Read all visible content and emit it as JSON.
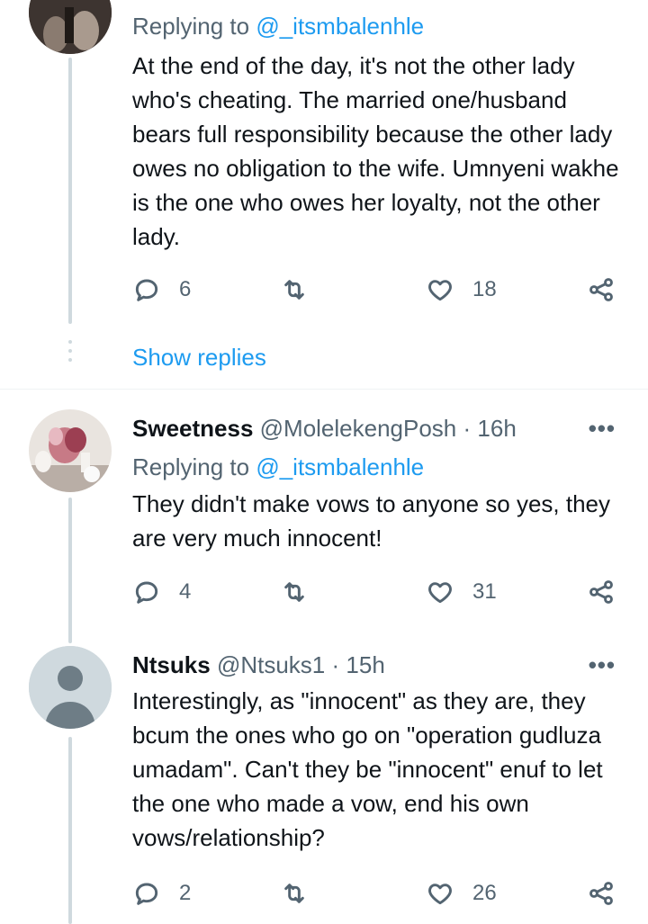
{
  "tweets": [
    {
      "replying_prefix": "Replying to",
      "replying_to": "@_itsmbalenhle",
      "text": "At the end of the day, it's not the other lady who's cheating. The married one/husband bears full responsibility because the other lady owes no obligation to the wife. Umnyeni wakhe is the one who owes her loyalty, not the other lady.",
      "replies": "6",
      "likes": "18",
      "show_replies": "Show replies"
    },
    {
      "name": "Sweetness",
      "handle": "@MolelekengPosh",
      "separator": "·",
      "time": "16h",
      "replying_prefix": "Replying to",
      "replying_to": "@_itsmbalenhle",
      "text": "They didn't make vows to anyone so yes, they are very much innocent!",
      "replies": "4",
      "likes": "31",
      "more": "•••"
    },
    {
      "name": "Ntsuks",
      "handle": "@Ntsuks1",
      "separator": "·",
      "time": "15h",
      "text": "Interestingly, as \"innocent\" as they are, they bcum the ones who go on \"operation gudluza umadam\". Can't they be \"innocent\" enuf to let the one who made a vow, end his own vows/relationship?",
      "replies": "2",
      "likes": "26",
      "more": "•••"
    }
  ],
  "icons": {
    "reply": "reply-icon",
    "retweet": "retweet-icon",
    "like": "heart-icon",
    "share": "share-icon"
  },
  "colors": {
    "link": "#1d9bf0",
    "muted": "#536471",
    "thread_line": "#cfd9de"
  }
}
